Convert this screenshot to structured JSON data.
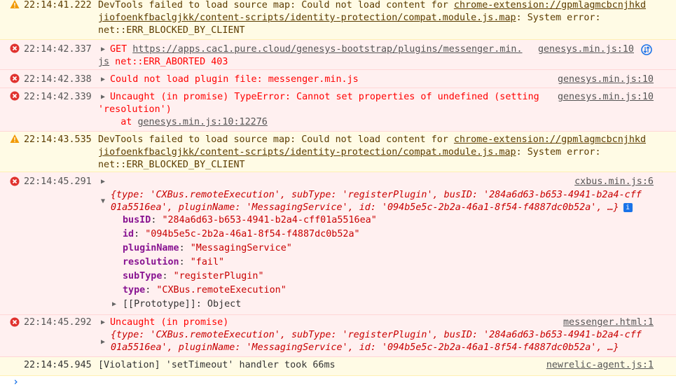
{
  "messages": [
    {
      "level": "warning",
      "timestamp": "22:14:41.222",
      "l1a": "DevTools failed to load source map: Could not load content for ",
      "l1link": "chrome-extension://gpmlagmcbcnjhkd",
      "l2link": "jiofoenkfbaclgjkk/content-scripts/identity-protection/compat.module.js.map",
      "l2b": ": System error:",
      "l3": "net::ERR_BLOCKED_BY_CLIENT"
    },
    {
      "level": "error",
      "timestamp": "22:14:42.337",
      "l1a": "GET ",
      "l1link": "https://apps.cac1.pure.cloud/genesys-bootstrap/plugins/messenger.min.",
      "l2link": "js",
      "l2b": " net::ERR_ABORTED 403",
      "source": "genesys.min.js:10",
      "icon": "network-request-icon"
    },
    {
      "level": "error",
      "timestamp": "22:14:42.338",
      "l1": "Could not load plugin file: messenger.min.js",
      "source": "genesys.min.js:10"
    },
    {
      "level": "error",
      "timestamp": "22:14:42.339",
      "l1": "Uncaught (in promise) TypeError: Cannot set properties of undefined (setting",
      "l2": "'resolution')",
      "l3a": "    at ",
      "l3link": "genesys.min.js:10:12276",
      "source": "genesys.min.js:10"
    },
    {
      "level": "warning",
      "timestamp": "22:14:43.535",
      "l1a": "DevTools failed to load source map: Could not load content for ",
      "l1link": "chrome-extension://gpmlagmcbcnjhkd",
      "l2link": "jiofoenkfbaclgjkk/content-scripts/identity-protection/compat.module.js.map",
      "l2b": ": System error:",
      "l3": "net::ERR_BLOCKED_BY_CLIENT"
    },
    {
      "level": "error",
      "timestamp": "22:14:45.291",
      "source": "cxbus.min.js:6",
      "preview1": "{type: 'CXBus.remoteExecution', subType: 'registerPlugin', busID: '284a6d63-b653-4941-b2a4-cff",
      "preview2": "01a5516ea', pluginName: 'MessagingService', id: '094b5e5c-2b2a-46a1-8f54-f4887dc0b52a', …}",
      "info_badge": "i",
      "props": [
        {
          "key": "busID",
          "value": "\"284a6d63-b653-4941-b2a4-cff01a5516ea\""
        },
        {
          "key": "id",
          "value": "\"094b5e5c-2b2a-46a1-8f54-f4887dc0b52a\""
        },
        {
          "key": "pluginName",
          "value": "\"MessagingService\""
        },
        {
          "key": "resolution",
          "value": "\"fail\""
        },
        {
          "key": "subType",
          "value": "\"registerPlugin\""
        },
        {
          "key": "type",
          "value": "\"CXBus.remoteExecution\""
        }
      ],
      "prototype": "[[Prototype]]: Object"
    },
    {
      "level": "error",
      "timestamp": "22:14:45.292",
      "l1": "Uncaught (in promise)",
      "source": "messenger.html:1",
      "preview1": "{type: 'CXBus.remoteExecution', subType: 'registerPlugin', busID: '284a6d63-b653-4941-b2a4-cff",
      "preview2": "01a5516ea', pluginName: 'MessagingService', id: '094b5e5c-2b2a-46a1-8f54-f4887dc0b52a', …}"
    },
    {
      "level": "violation",
      "timestamp": "22:14:45.945",
      "l1": "[Violation] 'setTimeout' handler took 66ms",
      "source": "newrelic-agent.js:1"
    }
  ],
  "prompt": "›",
  "colors": {
    "error": "#ff0000",
    "warning_bg": "#fffbe5",
    "error_bg": "#fff0f0",
    "link_blue": "#1a73e8"
  }
}
